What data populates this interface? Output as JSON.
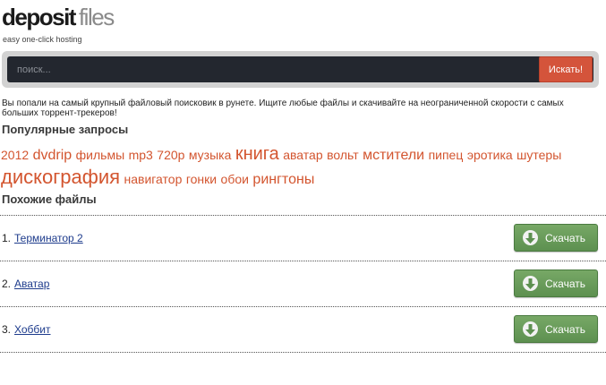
{
  "logo": {
    "part1": "deposit",
    "part2": "files",
    "tagline": "easy one-click hosting"
  },
  "search": {
    "placeholder": "поиск...",
    "button_label": "Искать!"
  },
  "intro_text": "Вы попали на самый крупный файловый поисковик в рунете. Ищите любые файлы и скачивайте на неограниченной скорости с самых больших торрент-трекеров!",
  "popular": {
    "heading": "Популярные запросы",
    "tags": [
      "2012",
      "dvdrip",
      "фильмы",
      "mp3",
      "720p",
      "музыка",
      "книга",
      "аватар",
      "вольт",
      "мстители",
      "пипец",
      "эротика",
      "шутеры",
      "дискография",
      "навигатор",
      "гонки",
      "обои",
      "рингтоны"
    ]
  },
  "similar": {
    "heading": "Похожие файлы",
    "items": [
      {
        "num": "1.",
        "title": "Терминатор 2",
        "button": "Скачать"
      },
      {
        "num": "2.",
        "title": "Аватар",
        "button": "Скачать"
      },
      {
        "num": "3.",
        "title": "Хоббит",
        "button": "Скачать"
      }
    ]
  },
  "colors": {
    "accent": "#d4543b",
    "tag": "#d3552f",
    "link": "#1d3b8c",
    "download": "#6a9c5a"
  },
  "icons": {
    "download": "download-arrow-icon"
  }
}
